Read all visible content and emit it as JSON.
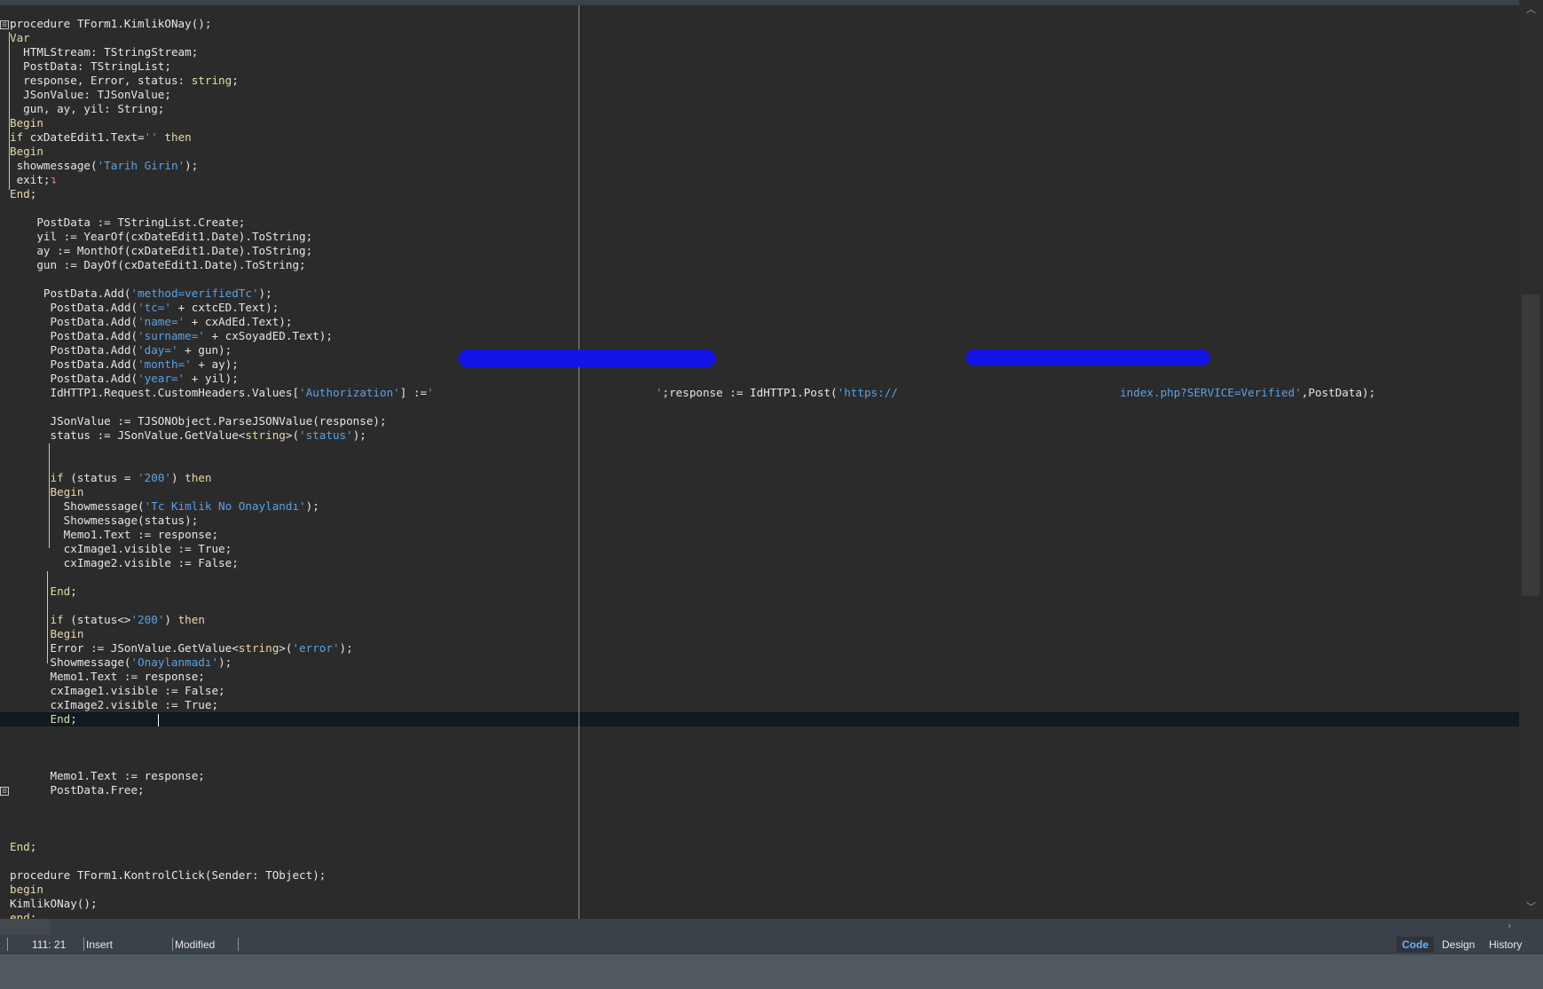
{
  "editor": {
    "lines": [
      [
        {
          "t": "procedure TForm1.KimlikONay();"
        }
      ],
      [
        {
          "t": "Var",
          "c": "kw"
        }
      ],
      [
        {
          "t": "  HTMLStream: TStringStream;"
        }
      ],
      [
        {
          "t": "  PostData: TStringList;"
        }
      ],
      [
        {
          "t": "  response, Error, status: "
        },
        {
          "t": "string",
          "c": "kw"
        },
        {
          "t": ";"
        }
      ],
      [
        {
          "t": "  JSonValue: TJSonValue;"
        }
      ],
      [
        {
          "t": "  gun, ay, yil: String;"
        }
      ],
      [
        {
          "t": "Begin",
          "c": "kw"
        }
      ],
      [
        {
          "t": "if",
          "c": "kw"
        },
        {
          "t": " cxDateEdit1.Text="
        },
        {
          "t": "''",
          "c": "str"
        },
        {
          "t": " "
        },
        {
          "t": "then",
          "c": "kw"
        }
      ],
      [
        {
          "t": "Begin",
          "c": "kw"
        }
      ],
      [
        {
          "t": " showmessage("
        },
        {
          "t": "'Tarih Girin'",
          "c": "str"
        },
        {
          "t": ");"
        }
      ],
      [
        {
          "t": " exit;"
        },
        {
          "t": "↴",
          "c": "bookmark"
        }
      ],
      [
        {
          "t": "End",
          "c": "kw"
        },
        {
          "t": ";"
        }
      ],
      [
        {
          "t": ""
        }
      ],
      [
        {
          "t": "    PostData := TStringList.Create;"
        }
      ],
      [
        {
          "t": "    yil := YearOf(cxDateEdit1.Date).ToString;"
        }
      ],
      [
        {
          "t": "    ay := MonthOf(cxDateEdit1.Date).ToString;"
        }
      ],
      [
        {
          "t": "    gun := DayOf(cxDateEdit1.Date).ToString;"
        }
      ],
      [
        {
          "t": ""
        }
      ],
      [
        {
          "t": "     PostData.Add("
        },
        {
          "t": "'method=verifiedTc'",
          "c": "str"
        },
        {
          "t": ");"
        }
      ],
      [
        {
          "t": "      PostData.Add("
        },
        {
          "t": "'tc='",
          "c": "str"
        },
        {
          "t": " + cxtcED.Text);"
        }
      ],
      [
        {
          "t": "      PostData.Add("
        },
        {
          "t": "'name='",
          "c": "str"
        },
        {
          "t": " + cxAdEd.Text);"
        }
      ],
      [
        {
          "t": "      PostData.Add("
        },
        {
          "t": "'surname='",
          "c": "str"
        },
        {
          "t": " + cxSoyadED.Text);"
        }
      ],
      [
        {
          "t": "      PostData.Add("
        },
        {
          "t": "'day='",
          "c": "str"
        },
        {
          "t": " + gun);"
        }
      ],
      [
        {
          "t": "      PostData.Add("
        },
        {
          "t": "'month='",
          "c": "str"
        },
        {
          "t": " + ay);"
        }
      ],
      [
        {
          "t": "      PostData.Add("
        },
        {
          "t": "'year='",
          "c": "str"
        },
        {
          "t": " + yil);"
        }
      ],
      [
        {
          "t": "      IdHTTP1.Request.CustomHeaders.Values["
        },
        {
          "t": "'Authorization'",
          "c": "str"
        },
        {
          "t": "] :="
        },
        {
          "t": "'                                 '",
          "c": "str"
        },
        {
          "t": ";response := IdHTTP1.Post("
        },
        {
          "t": "'https://                                 index.php?SERVICE=Verified'",
          "c": "str"
        },
        {
          "t": ",PostData);"
        }
      ],
      [
        {
          "t": ""
        }
      ],
      [
        {
          "t": "      JSonValue := TJSONObject.ParseJSONValue(response);"
        }
      ],
      [
        {
          "t": "      status := JSonValue.GetValue<"
        },
        {
          "t": "string",
          "c": "kw"
        },
        {
          "t": ">("
        },
        {
          "t": "'status'",
          "c": "str"
        },
        {
          "t": ");"
        }
      ],
      [
        {
          "t": ""
        }
      ],
      [
        {
          "t": ""
        }
      ],
      [
        {
          "t": "      if",
          "c": "kw"
        },
        {
          "t": " (status = "
        },
        {
          "t": "'200'",
          "c": "str"
        },
        {
          "t": ") "
        },
        {
          "t": "then",
          "c": "kw"
        }
      ],
      [
        {
          "t": "      Begin",
          "c": "kw"
        }
      ],
      [
        {
          "t": "        Showmessage("
        },
        {
          "t": "'Tc Kimlik No Onaylandı'",
          "c": "str"
        },
        {
          "t": ");"
        }
      ],
      [
        {
          "t": "        Showmessage(status);"
        }
      ],
      [
        {
          "t": "        Memo1.Text := response;"
        }
      ],
      [
        {
          "t": "        cxImage1.visible := True;"
        }
      ],
      [
        {
          "t": "        cxImage2.visible := False;"
        }
      ],
      [
        {
          "t": ""
        }
      ],
      [
        {
          "t": "      End",
          "c": "kw"
        },
        {
          "t": ";"
        }
      ],
      [
        {
          "t": ""
        }
      ],
      [
        {
          "t": "      if",
          "c": "kw"
        },
        {
          "t": " (status<>"
        },
        {
          "t": "'200'",
          "c": "str"
        },
        {
          "t": ") "
        },
        {
          "t": "then",
          "c": "kw"
        }
      ],
      [
        {
          "t": "      Begin",
          "c": "kw"
        }
      ],
      [
        {
          "t": "      Error := JSonValue.GetValue<"
        },
        {
          "t": "string",
          "c": "kw"
        },
        {
          "t": ">("
        },
        {
          "t": "'error'",
          "c": "str"
        },
        {
          "t": ");"
        }
      ],
      [
        {
          "t": "      Showmessage("
        },
        {
          "t": "'Onaylanmadı'",
          "c": "str"
        },
        {
          "t": ");"
        }
      ],
      [
        {
          "t": "      Memo1.Text := response;"
        }
      ],
      [
        {
          "t": "      cxImage1.visible := False;"
        }
      ],
      [
        {
          "t": "      cxImage2.visible := True;"
        }
      ],
      [
        {
          "t": "      End",
          "c": "kw"
        },
        {
          "t": ";            "
        }
      ],
      [
        {
          "t": ""
        }
      ],
      [
        {
          "t": ""
        }
      ],
      [
        {
          "t": ""
        }
      ],
      [
        {
          "t": "      Memo1.Text := response;"
        }
      ],
      [
        {
          "t": "      PostData.Free;"
        }
      ],
      [
        {
          "t": ""
        }
      ],
      [
        {
          "t": ""
        }
      ],
      [
        {
          "t": ""
        }
      ],
      [
        {
          "t": "End",
          "c": "kw"
        },
        {
          "t": ";"
        }
      ],
      [
        {
          "t": ""
        }
      ],
      [
        {
          "t": "procedure TForm1.KontrolClick(Sender: TObject);"
        }
      ],
      [
        {
          "t": "begin",
          "c": "kw"
        }
      ],
      [
        {
          "t": "KimlikONay();"
        }
      ],
      [
        {
          "t": "end",
          "c": "kw"
        },
        {
          "t": ";"
        }
      ]
    ],
    "current_line_index": 49,
    "fold_markers": [
      "⊟",
      "⊟"
    ]
  },
  "statusbar": {
    "position": "111: 21",
    "mode": "Insert",
    "state": "Modified"
  },
  "view_tabs": [
    {
      "label": "Code",
      "active": true
    },
    {
      "label": "Design",
      "active": false
    },
    {
      "label": "History",
      "active": false
    }
  ],
  "colors": {
    "background": "#2b2b2b",
    "keyword": "#e8d9a8",
    "string": "#5aa2e4",
    "current_line": "#0f1a22",
    "redaction": "#1414e8",
    "active_tab_text": "#6ab0ff"
  },
  "icons": {
    "fold": "minus-box-icon",
    "scroll_up": "chevron-up-icon",
    "scroll_down": "chevron-down-icon",
    "scroll_right": "chevron-right-icon",
    "bookmark": "line-break-arrow-icon"
  }
}
